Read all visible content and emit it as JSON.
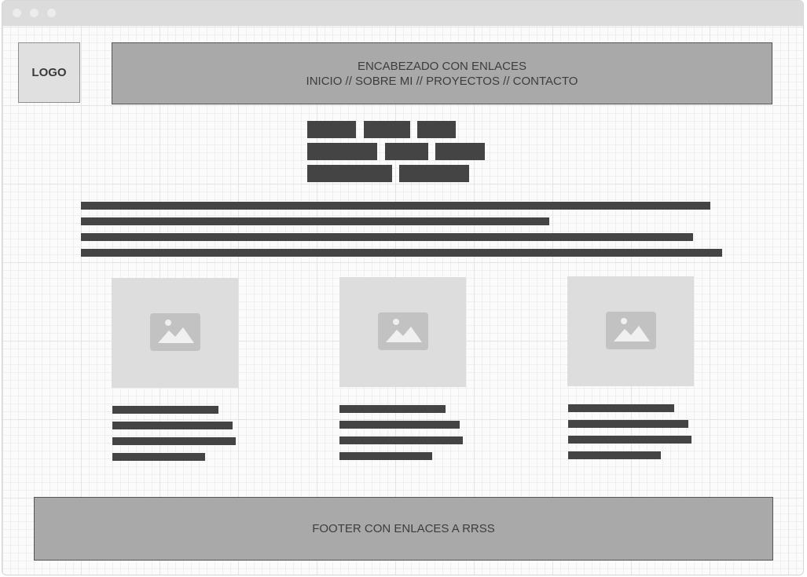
{
  "logo": {
    "label": "LOGO"
  },
  "header": {
    "title": "ENCABEZADO CON ENLACES",
    "links": "INICIO // SOBRE MI // PROYECTOS // CONTACTO"
  },
  "cards": [
    {
      "image": "image-placeholder-icon"
    },
    {
      "image": "image-placeholder-icon"
    },
    {
      "image": "image-placeholder-icon"
    }
  ],
  "footer": {
    "label": "FOOTER CON ENLACES A RRSS"
  },
  "colors": {
    "block": "#444444",
    "header_bg": "#a9a9a9",
    "thumb_bg": "#dddddd",
    "icon_bg": "#c2c2c2"
  }
}
